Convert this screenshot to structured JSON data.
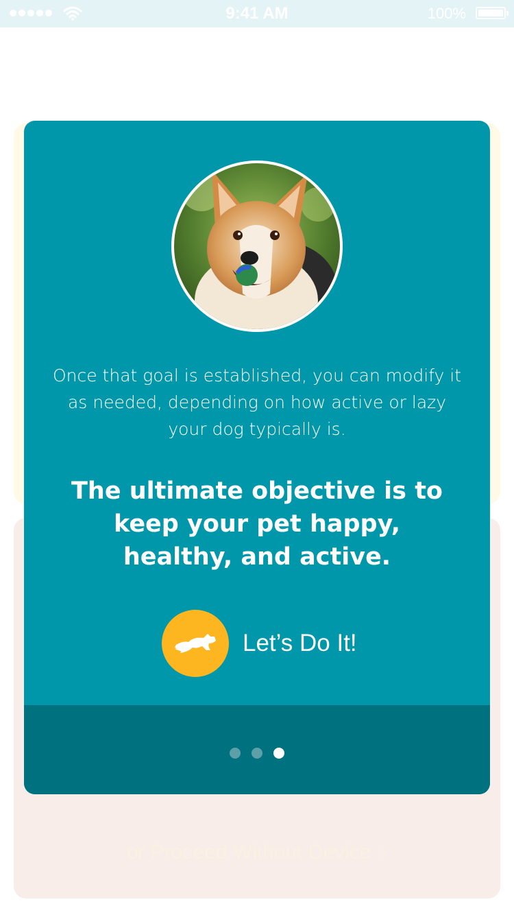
{
  "status_bar": {
    "time": "9:41 AM",
    "battery": "100%",
    "signal_icon": "signal-dots-icon",
    "wifi_icon": "wifi-icon",
    "battery_icon": "battery-icon"
  },
  "card": {
    "body_text": "Once that goal is established, you can modify it as needed, depending on how active or lazy your dog typically is.",
    "headline": "The ultimate objective is to keep your pet happy, healthy, and active.",
    "cta_label": "Let’s Do It!",
    "cta_icon": "running-dog-icon",
    "pagination": {
      "total": 3,
      "current": 3
    }
  },
  "background": {
    "proceed_label": "or Proceed Without Device",
    "proceed_icon": "chevron-right-icon"
  },
  "colors": {
    "card": "#0097aa",
    "card_footer": "#00727f",
    "cta": "#fdb61f",
    "status_bar": "#e4f3f5",
    "bg_card_yellow": "#fff9e6",
    "bg_card_peach": "#f8ede8"
  }
}
